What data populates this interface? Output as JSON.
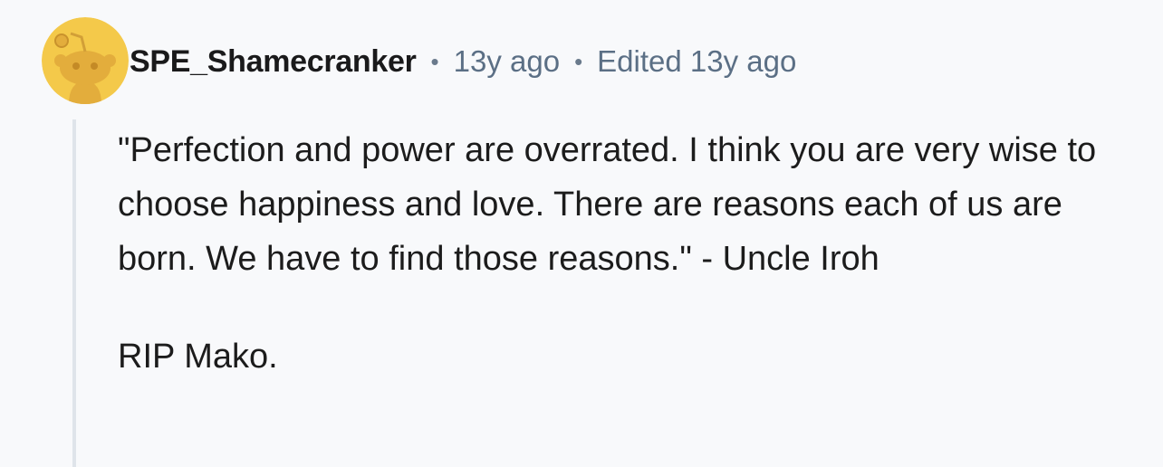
{
  "comment": {
    "author": "SPE_Shamecranker",
    "separator": "•",
    "posted": "13y ago",
    "edited": "Edited 13y ago",
    "avatar_color": "#f4c94a",
    "avatar_icon": "snoo-avatar-icon",
    "paragraphs": [
      "\"Perfection and power are overrated. I think you are very wise to choose happiness and love. There are reasons each of us are born. We have to find those reasons.\" - Uncle Iroh",
      "RIP Mako."
    ]
  }
}
